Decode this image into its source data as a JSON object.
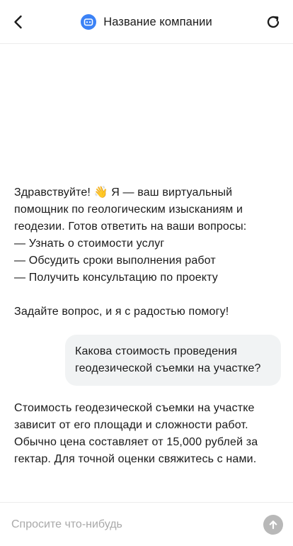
{
  "header": {
    "title": "Название компании",
    "back_icon": "chevron-left-icon",
    "refresh_icon": "refresh-icon",
    "avatar_icon": "bot-icon",
    "accent_color": "#3b82f6"
  },
  "messages": [
    {
      "role": "bot",
      "text": "Здравствуйте! 👋 Я — ваш виртуальный помощник по геологическим изысканиям и геодезии. Готов ответить на ваши вопросы:\n— Узнать о стоимости услуг\n— Обсудить сроки выполнения работ\n— Получить консультацию по проекту\n\nЗадайте вопрос, и я с радостью помогу!"
    },
    {
      "role": "user",
      "text": "Какова стоимость проведения геодезической съемки на участке?"
    },
    {
      "role": "bot",
      "text": "Стоимость геодезической съемки на участке зависит от его площади и сложности работ. Обычно цена составляет от 15,000 рублей за гектар. Для точной оценки свяжитесь с нами."
    }
  ],
  "composer": {
    "placeholder": "Спросите что-нибудь",
    "value": "",
    "send_icon": "arrow-up-icon"
  }
}
